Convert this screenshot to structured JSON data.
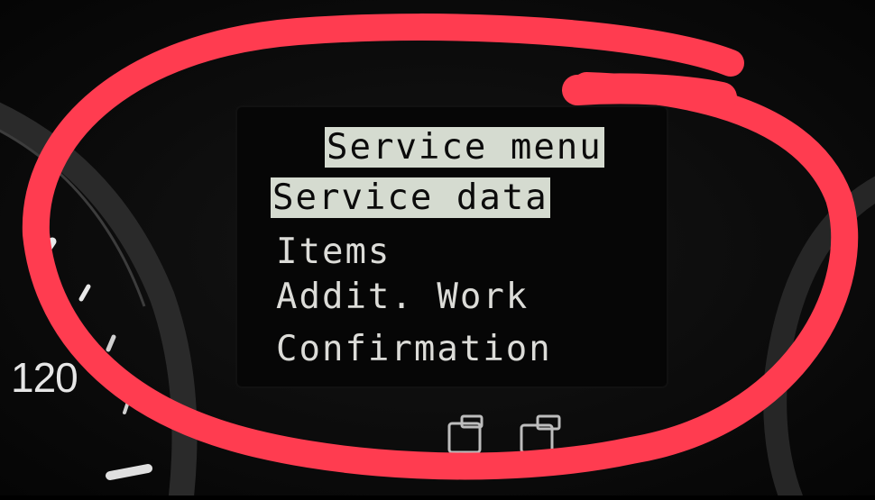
{
  "display": {
    "title": "Service menu",
    "items": [
      {
        "label": "Service data",
        "selected": true
      },
      {
        "label": "Items",
        "selected": false
      },
      {
        "label": "Addit. Work",
        "selected": false
      },
      {
        "label": "Confirmation",
        "selected": false
      }
    ]
  },
  "gauge": {
    "speed_label": "120"
  },
  "colors": {
    "annotation": "#ff3c50",
    "highlight": "#d5dbd0",
    "display_text": "#dcdcd8",
    "background": "#000000"
  },
  "icons": [
    "page-icon",
    "page-icon"
  ]
}
